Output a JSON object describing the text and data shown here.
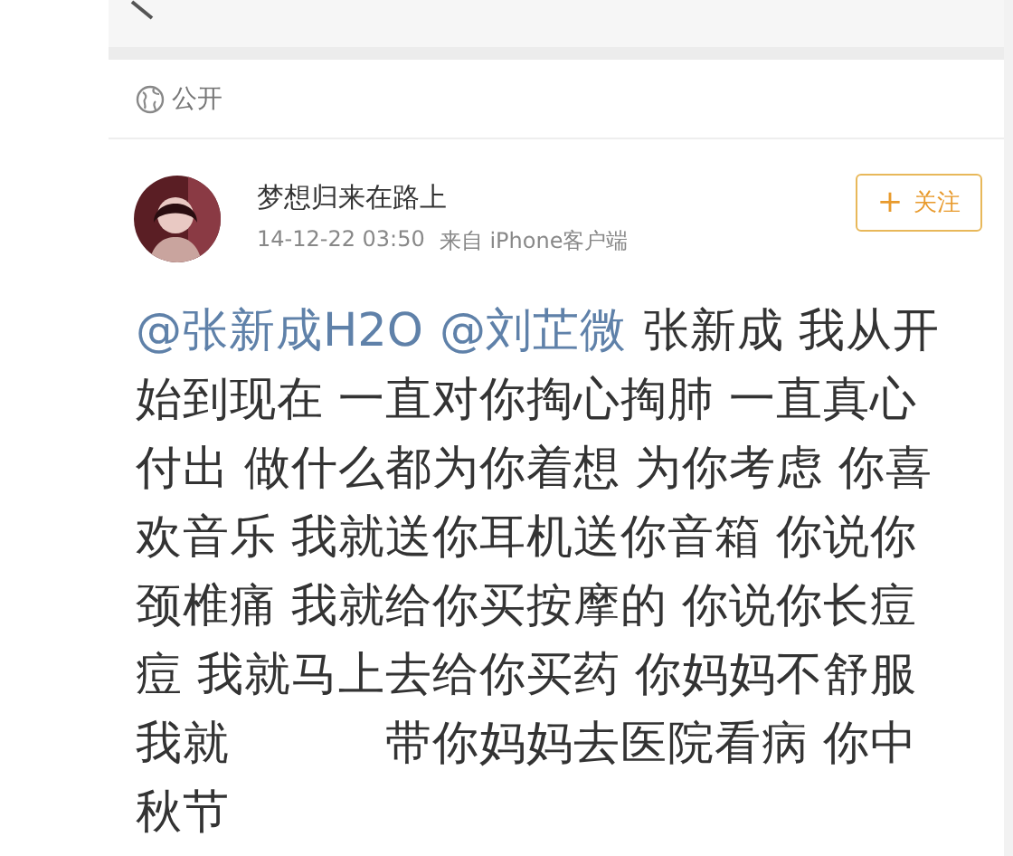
{
  "visibility": {
    "label": "公开"
  },
  "author": {
    "name": "梦想归来在路上",
    "time": "14-12-22 03:50",
    "source": "来自 iPhone客户端"
  },
  "follow_button": {
    "plus": "+",
    "label": "关注"
  },
  "post": {
    "lines": [
      [
        {
          "kind": "mention",
          "text": "@张新成H2O"
        },
        {
          "kind": "mention",
          "text": "@刘芷微"
        },
        {
          "kind": "text",
          "text": "张新成 我从开"
        }
      ],
      [
        {
          "kind": "text",
          "text": "始到现在 一直对你掏心掏肺 一直真心"
        }
      ],
      [
        {
          "kind": "text",
          "text": "付出 做什么都为你着想 为你考虑 你喜"
        }
      ],
      [
        {
          "kind": "text",
          "text": "欢音乐 我就送你耳机送你音箱 你说你"
        }
      ],
      [
        {
          "kind": "text",
          "text": "颈椎痛 我就给你买按摩的 你说你长痘"
        }
      ],
      [
        {
          "kind": "text",
          "text": "痘 我就马上去给你买药 你妈妈不舒服"
        }
      ],
      [
        {
          "kind": "text",
          "text": "我就"
        },
        {
          "kind": "gap"
        },
        {
          "kind": "text",
          "text": "带你妈妈去医院看病 你中"
        }
      ],
      [
        {
          "kind": "text",
          "text": "秋节"
        }
      ]
    ]
  }
}
